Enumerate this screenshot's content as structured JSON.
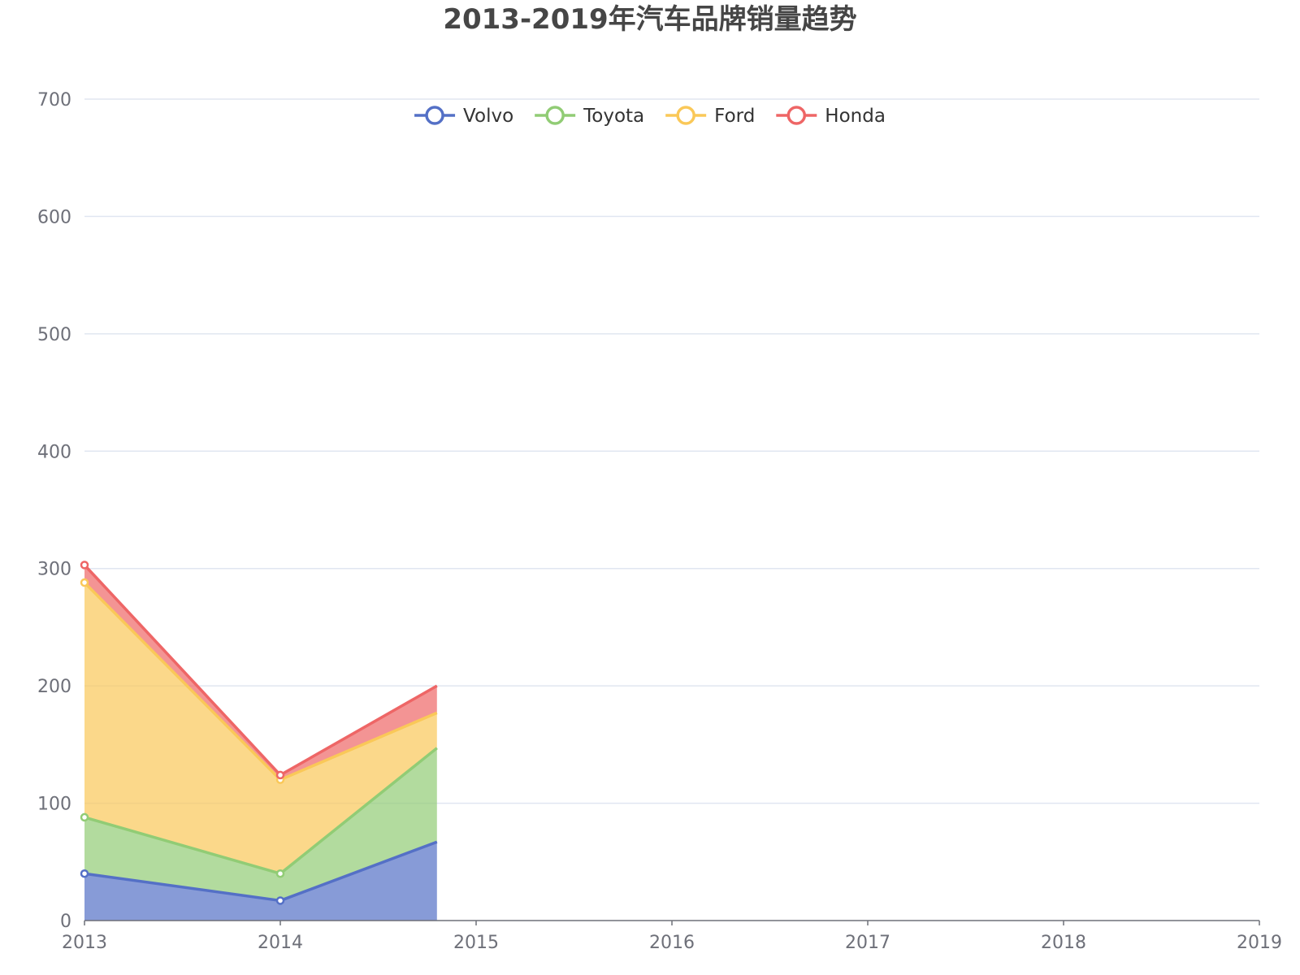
{
  "chart_data": {
    "type": "area",
    "stacked": true,
    "title": "2013-2019年汽车品牌销量趋势",
    "xlabel": "",
    "ylabel": "",
    "x": [
      2013,
      2014,
      2014.8
    ],
    "x_ticks": [
      "2013",
      "2014",
      "2015",
      "2016",
      "2017",
      "2018",
      "2019"
    ],
    "xlim": [
      2013,
      2019
    ],
    "ylim": [
      0,
      700
    ],
    "y_ticks": [
      0,
      100,
      200,
      300,
      400,
      500,
      600,
      700
    ],
    "grid": true,
    "legend_position": "top-center",
    "series": [
      {
        "name": "Volvo",
        "color": "#5470c6",
        "values": [
          40,
          17,
          67
        ]
      },
      {
        "name": "Toyota",
        "color": "#91cc75",
        "values": [
          48,
          23,
          80
        ]
      },
      {
        "name": "Ford",
        "color": "#fac858",
        "values": [
          200,
          80,
          30
        ]
      },
      {
        "name": "Honda",
        "color": "#ee6666",
        "values": [
          15,
          4,
          23
        ]
      }
    ]
  }
}
